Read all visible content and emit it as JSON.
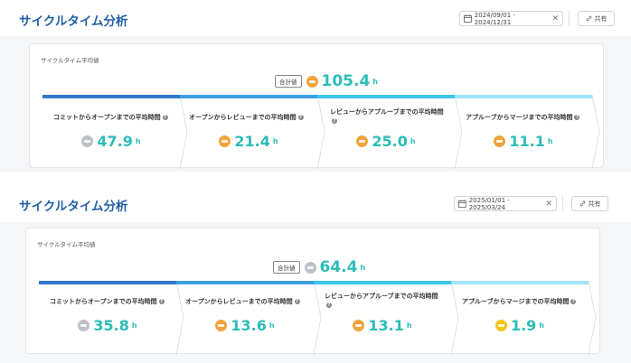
{
  "panels": [
    {
      "title": "サイクルタイム分析",
      "date_range": "2024/09/01 - 2024/12/31",
      "share_label": "共有",
      "card_label": "サイクルタイム平均値",
      "total_tag": "合計値",
      "total_value": "105.4",
      "total_icon": "orange-face-icon",
      "unit": "h",
      "stages": [
        {
          "label": "コミットからオープンまでの平均時間",
          "value": "47.9",
          "icon": "gray-face-icon"
        },
        {
          "label": "オープンからレビューまでの平均時間",
          "value": "21.4",
          "icon": "orange-face-icon"
        },
        {
          "label": "レビューからアプルーブまでの平均時間",
          "value": "25.0",
          "icon": "orange-face-icon"
        },
        {
          "label": "アプルーブからマージまでの平均時間",
          "value": "11.1",
          "icon": "orange-face-icon"
        }
      ]
    },
    {
      "title": "サイクルタイム分析",
      "date_range": "2025/01/01 - 2025/03/24",
      "share_label": "共有",
      "card_label": "サイクルタイム平均値",
      "total_tag": "合計値",
      "total_value": "64.4",
      "total_icon": "gray-face-icon",
      "unit": "h",
      "stages": [
        {
          "label": "コミットからオープンまでの平均時間",
          "value": "35.8",
          "icon": "gray-face-icon"
        },
        {
          "label": "オープンからレビューまでの平均時間",
          "value": "13.6",
          "icon": "orange-face-icon"
        },
        {
          "label": "レビューからアプルーブまでの平均時間",
          "value": "13.1",
          "icon": "orange-face-icon"
        },
        {
          "label": "アプルーブからマージまでの平均時間",
          "value": "1.9",
          "icon": "yellow-face-icon"
        }
      ]
    }
  ],
  "colors": {
    "title": "#1f5fa8",
    "value": "#2bbdb8",
    "stage_bars": [
      "#2f79c8",
      "#3e9de0",
      "#3cc6ee",
      "#9fe4f7"
    ]
  }
}
